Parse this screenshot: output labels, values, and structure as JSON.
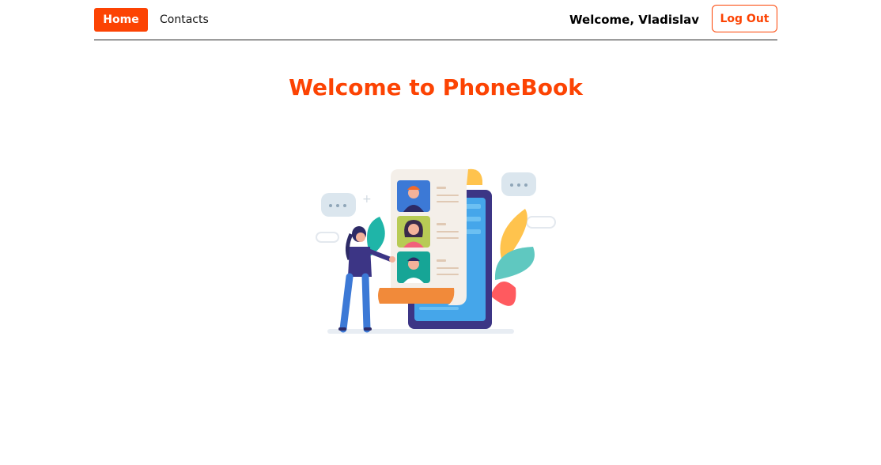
{
  "header": {
    "home_label": "Home",
    "contacts_label": "Contacts",
    "welcome_text": "Welcome, Vladislav",
    "logout_label": "Log Out"
  },
  "main": {
    "title": "Welcome to PhoneBook",
    "illustration": "phonebook-contacts-illustration"
  },
  "colors": {
    "accent": "#fc4303",
    "text": "#000000",
    "background": "#ffffff"
  }
}
